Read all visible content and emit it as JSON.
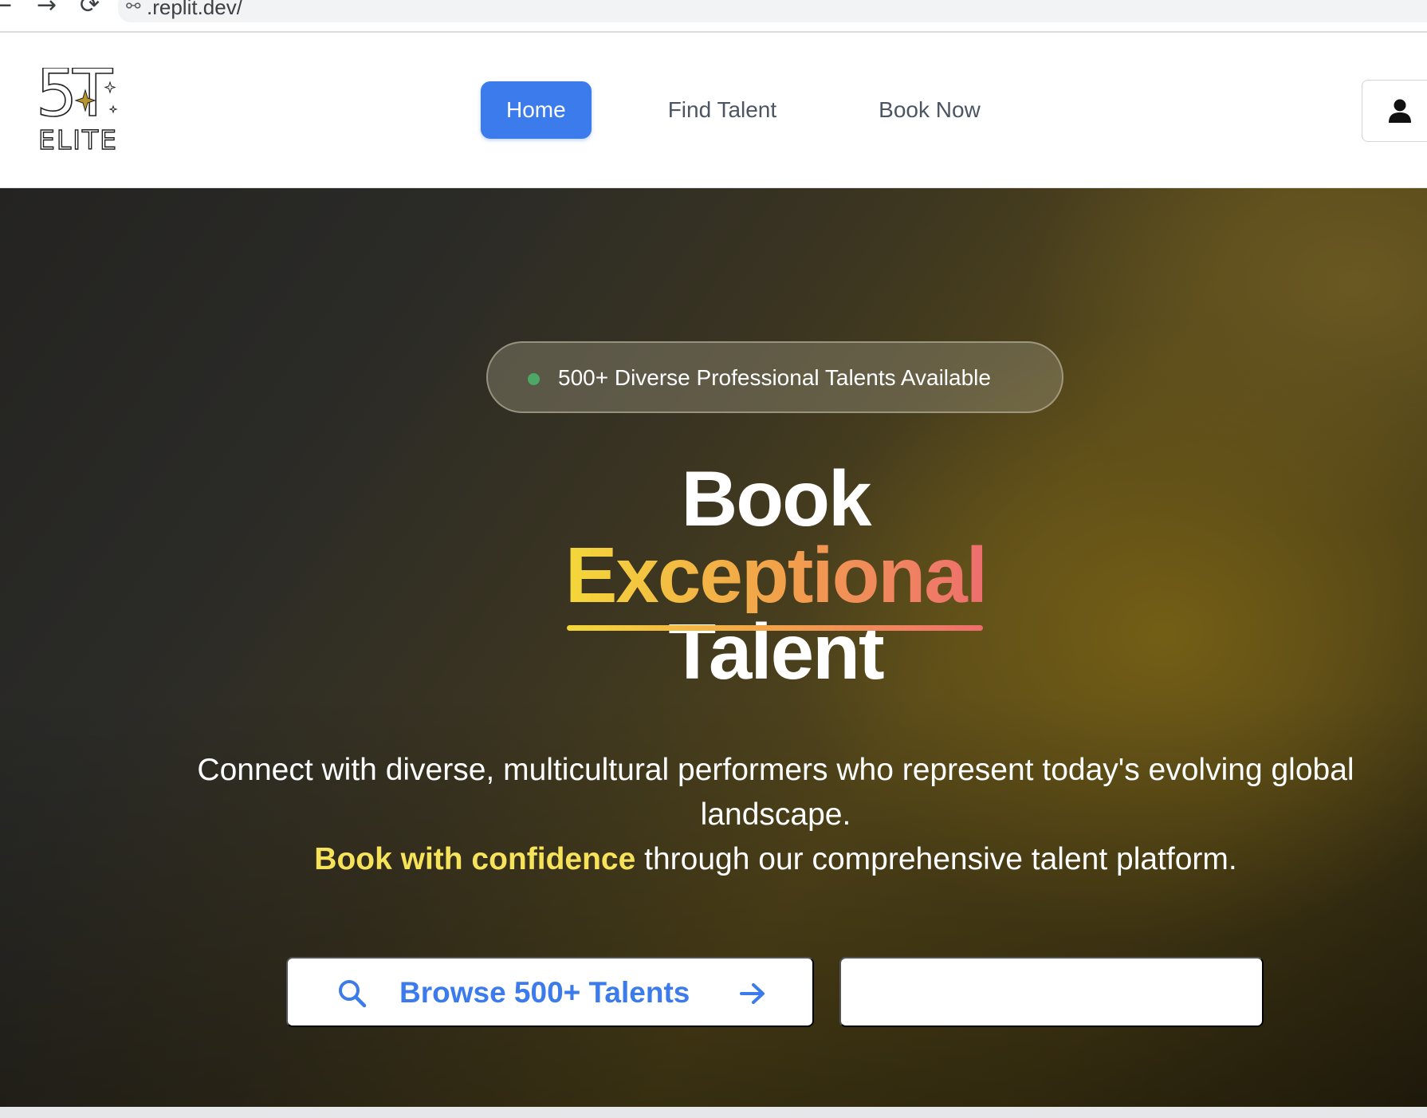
{
  "browser": {
    "url": ".replit.dev/",
    "back_glyph": "←",
    "forward_glyph": "→",
    "reload_glyph": "⟳",
    "link_glyph": "⚯"
  },
  "header": {
    "logo": {
      "top": "5T",
      "bottom": "ELITE"
    },
    "nav": [
      {
        "label": "Home",
        "active": true
      },
      {
        "label": "Find Talent",
        "active": false
      },
      {
        "label": "Book Now",
        "active": false
      }
    ],
    "user_icon": "user-icon"
  },
  "hero": {
    "badge_text": "500+ Diverse Professional Talents Available",
    "headline": {
      "line1": "Book",
      "line2": "Exceptional",
      "line3": "Talent"
    },
    "description": {
      "line1": "Connect with diverse, multicultural performers who represent today's evolving global landscape.",
      "highlight": "Book with confidence",
      "rest": " through our comprehensive talent platform."
    },
    "primary_button": "Browse 500+ Talents",
    "secondary_button": ""
  },
  "colors": {
    "accent_blue": "#3b7beb",
    "highlight_yellow": "#f7e35a",
    "badge_dot": "#4ea865",
    "gradient_start": "#f4d83a",
    "gradient_end": "#ee6e6f"
  }
}
